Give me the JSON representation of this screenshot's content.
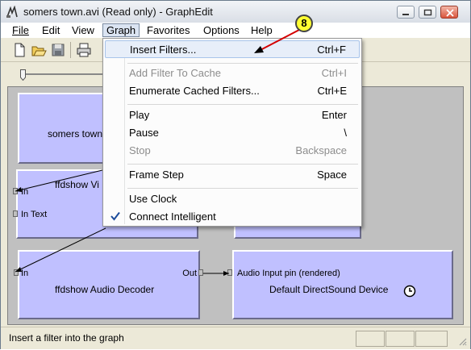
{
  "window": {
    "title": "somers town.avi (Read only) - GraphEdit"
  },
  "menubar": {
    "items": [
      {
        "label": "File"
      },
      {
        "label": "Edit"
      },
      {
        "label": "View"
      },
      {
        "label": "Graph"
      },
      {
        "label": "Favorites"
      },
      {
        "label": "Options"
      },
      {
        "label": "Help"
      }
    ],
    "active": "Graph"
  },
  "toolbar": {
    "icons": [
      "new-icon",
      "open-icon",
      "save-icon",
      "print-icon"
    ]
  },
  "graph_menu": {
    "items": [
      {
        "label": "Insert Filters...",
        "shortcut": "Ctrl+F",
        "state": "highlighted"
      },
      {
        "label": "Add Filter To Cache",
        "shortcut": "Ctrl+I",
        "state": "disabled"
      },
      {
        "label": "Enumerate Cached Filters...",
        "shortcut": "Ctrl+E",
        "state": "enabled"
      },
      {
        "label": "Play",
        "shortcut": "Enter",
        "state": "enabled"
      },
      {
        "label": "Pause",
        "shortcut": "\\",
        "state": "enabled"
      },
      {
        "label": "Stop",
        "shortcut": "Backspace",
        "state": "disabled"
      },
      {
        "label": "Frame Step",
        "shortcut": "Space",
        "state": "enabled"
      },
      {
        "label": "Use Clock",
        "shortcut": "",
        "state": "enabled"
      },
      {
        "label": "Connect Intelligent",
        "shortcut": "",
        "state": "checked"
      }
    ]
  },
  "filters": {
    "source": {
      "name": "somers town"
    },
    "video_decoder": {
      "name": "ffdshow Vi",
      "pins": [
        "In",
        "In Text"
      ]
    },
    "audio_decoder": {
      "name": "ffdshow Audio Decoder",
      "pin_in": "In",
      "pin_out": "Out"
    },
    "audio_renderer": {
      "name": "Default DirectSound Device",
      "pin_in": "Audio Input pin (rendered)"
    }
  },
  "status": {
    "text": "Insert a filter into the graph"
  },
  "annotation": {
    "step": "8",
    "color": "#ffff33",
    "arrow_color": "#d40000"
  },
  "colors": {
    "filter_fill": "#c0c0ff",
    "canvas": "#c0c0c0",
    "menu_highlight": "#e7eef9"
  }
}
